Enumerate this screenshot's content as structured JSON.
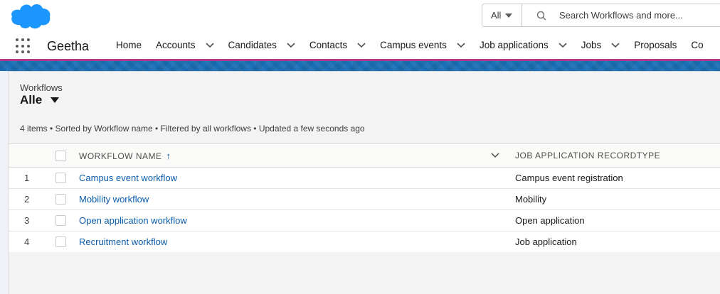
{
  "header": {
    "search_scope": "All",
    "search_placeholder": "Search Workflows and more..."
  },
  "nav": {
    "app_name": "Geetha",
    "items": [
      {
        "label": "Home",
        "has_menu": false
      },
      {
        "label": "Accounts",
        "has_menu": true
      },
      {
        "label": "Candidates",
        "has_menu": true
      },
      {
        "label": "Contacts",
        "has_menu": true
      },
      {
        "label": "Campus events",
        "has_menu": true
      },
      {
        "label": "Job applications",
        "has_menu": true
      },
      {
        "label": "Jobs",
        "has_menu": true
      },
      {
        "label": "Proposals",
        "has_menu": false
      },
      {
        "label": "Co",
        "has_menu": false
      }
    ]
  },
  "list": {
    "object_label": "Workflows",
    "view_name": "Alle",
    "info": "4 items • Sorted by Workflow name • Filtered by all workflows • Updated a few seconds ago",
    "columns": {
      "name": "WORKFLOW NAME",
      "type": "JOB APPLICATION RECORDTYPE"
    },
    "sort_icon": "arrow-up-icon",
    "rows": [
      {
        "num": "1",
        "name": "Campus event workflow",
        "type": "Campus event registration"
      },
      {
        "num": "2",
        "name": "Mobility workflow",
        "type": "Mobility"
      },
      {
        "num": "3",
        "name": "Open application workflow",
        "type": "Open application"
      },
      {
        "num": "4",
        "name": "Recruitment workflow",
        "type": "Job application"
      }
    ]
  },
  "colors": {
    "brand_blue": "#1b96ff",
    "link": "#0b5cab",
    "nav_accent": "#b13a8a"
  }
}
